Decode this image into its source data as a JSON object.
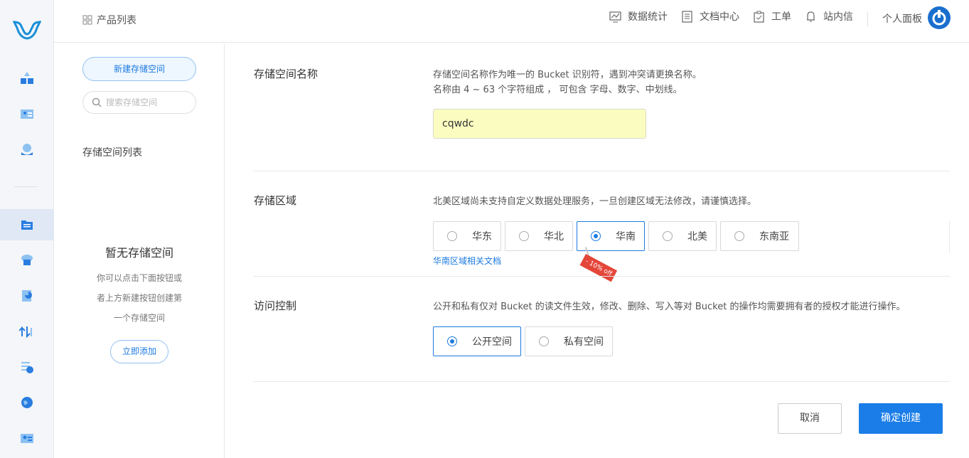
{
  "rail": {
    "items": [
      "logo-icon",
      "apps-icon",
      "id-card-icon",
      "billing-icon",
      "storage-icon",
      "cloud-db-icon",
      "chart-doc-icon",
      "transfer-icon",
      "report-icon",
      "globe-icon",
      "profile-card-icon"
    ],
    "active": "storage-icon"
  },
  "header": {
    "breadcrumb": "产品列表",
    "nav": [
      "数据统计",
      "文档中心",
      "工单",
      "站内信"
    ],
    "personal": "个人面板"
  },
  "sidebar": {
    "new_bucket": "新建存储空间",
    "search_placeholder": "搜索存储空间",
    "list_title": "存储空间列表",
    "empty_title": "暂无存储空间",
    "empty_lines": [
      "你可以点击下面按钮或",
      "者上方新建按钮创建第",
      "一个存储空间"
    ],
    "add_now": "立即添加"
  },
  "form": {
    "name": {
      "label": "存储空间名称",
      "desc_line1": "存储空间名称作为唯一的 Bucket 识别符，遇到冲突请更换名称。",
      "desc_line2": "名称由 4 ~ 63 个字符组成 ， 可包含 字母、数字、中划线。",
      "value": "cqwdc"
    },
    "region": {
      "label": "存储区域",
      "desc": "北美区域尚未支持自定义数据处理服务，一旦创建区域无法修改，请谨慎选择。",
      "options": [
        "华东",
        "华北",
        "华南",
        "北美",
        "东南亚"
      ],
      "selected": "华南",
      "doc_link": "华南区域相关文档",
      "badge": "- 10% off"
    },
    "access": {
      "label": "访问控制",
      "desc": "公开和私有仅对 Bucket 的读文件生效，修改、删除、写入等对 Bucket 的操作均需要拥有者的授权才能进行操作。",
      "options": [
        "公开空间",
        "私有空间"
      ],
      "selected": "公开空间"
    },
    "cancel": "取消",
    "confirm": "确定创建"
  },
  "colors": {
    "accent": "#1a7de8",
    "input_bg": "#fbfdc0",
    "badge": "#e4463a"
  }
}
